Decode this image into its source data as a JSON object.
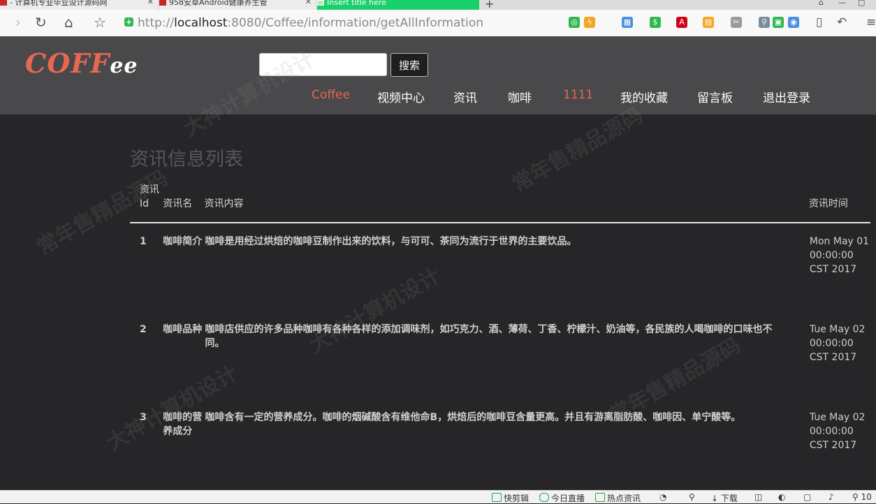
{
  "browser": {
    "tabs": [
      {
        "title": "- 计算机专业毕业设计源码网"
      },
      {
        "title": "958安卓Android健康养生管"
      },
      {
        "title": "Insert title here"
      }
    ],
    "url_prefix": "http://",
    "url_host": "localhost",
    "url_path": ":8080/Coffee/information/getAllInformation"
  },
  "site": {
    "logo_main": "COFF",
    "logo_tail": "ee",
    "search": {
      "value": "",
      "button_label": "搜索"
    },
    "nav": [
      {
        "label": "Coffee",
        "active": true
      },
      {
        "label": "视频中心"
      },
      {
        "label": "资讯"
      },
      {
        "label": "咖啡"
      },
      {
        "label": "1111",
        "accent": true
      },
      {
        "label": "我的收藏"
      },
      {
        "label": "留言板"
      },
      {
        "label": "退出登录"
      }
    ],
    "accent_color": "#e8684f"
  },
  "main": {
    "title": "资讯信息列表",
    "columns": [
      "资讯Id",
      "资讯名",
      "资讯内容",
      "资讯时间"
    ],
    "rows": [
      {
        "id": "1",
        "name": "咖啡简介",
        "content": "咖啡是用经过烘焙的咖啡豆制作出来的饮料，与可可、茶同为流行于世界的主要饮品。",
        "time": "Mon May 01 00:00:00 CST 2017"
      },
      {
        "id": "2",
        "name": "咖啡品种",
        "content": "咖啡店供应的许多品种咖啡有各种各样的添加调味剂，如巧克力、酒、薄荷、丁香、柠檬汁、奶油等，各民族的人喝咖啡的口味也不同。",
        "time": "Tue May 02 00:00:00 CST 2017"
      },
      {
        "id": "3",
        "name": "咖啡的营养成分",
        "content": "咖啡含有一定的营养成分。咖啡的烟碱酸含有维他命B，烘焙后的咖啡豆含量更高。并且有游离脂肪酸、咖啡因、单宁酸等。",
        "time": "Tue May 02 00:00:00 CST 2017"
      }
    ]
  },
  "statusbar": {
    "items": [
      "快剪辑",
      "今日直播",
      "热点资讯",
      "下载"
    ],
    "zoom": "10"
  }
}
